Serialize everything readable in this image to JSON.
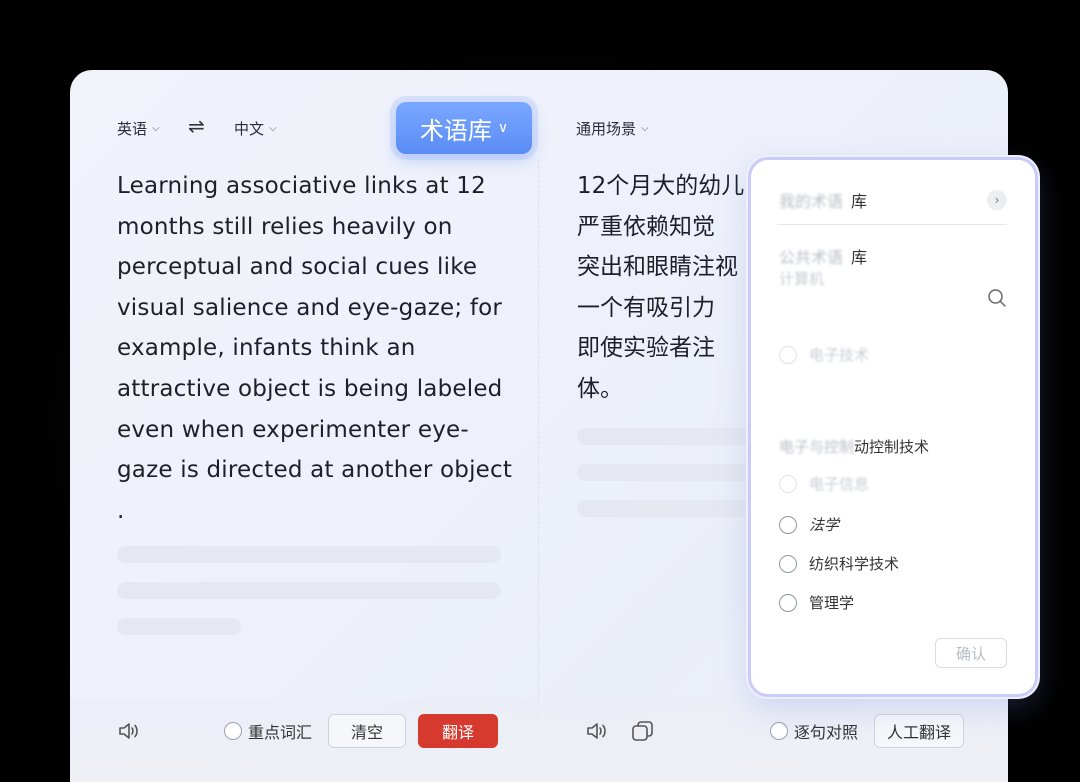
{
  "header": {
    "source_lang": "英语",
    "target_lang": "中文",
    "swap_symbol": "⇌",
    "term_button": "术语库",
    "scene_selector": "通用场景"
  },
  "source_text": "Learning associative links at 12 months still relies heavily on perceptual and social cues like visual salience and eye-gaze; for example, infants think an attractive object is being labeled even when experimenter eye-gaze is directed at another object .",
  "target_text": "12个月大的幼儿\n严重依赖知觉\n突出和眼睛注视\n一个有吸引力\n即使实验者注\n体。",
  "toolbar_left": {
    "key_vocab_label": "重点词汇",
    "clear_label": "清空",
    "translate_label": "翻译"
  },
  "toolbar_right": {
    "sentence_compare_label": "逐句对照",
    "human_translate_label": "人工翻译"
  },
  "term_panel": {
    "row1_blurred": "我的术语",
    "row1_suffix": "库",
    "row2_blurred": "公共术语",
    "row2_suffix": "库",
    "faint_items": [
      "计算机",
      "",
      "电子技术",
      "",
      ""
    ],
    "category_blurred": "电子与控制",
    "category_suffix": "动控制技术",
    "options": [
      {
        "label": "电子信息",
        "faint": true
      },
      {
        "label": "法学",
        "faint": false
      },
      {
        "label": "纺织科学技术",
        "faint": false
      },
      {
        "label": "管理学",
        "faint": false
      }
    ],
    "confirm_label": "确认"
  },
  "colors": {
    "accent_blue": "#5a8cf6",
    "translate_red": "#d63a2e",
    "panel_border": "#c9ccf8"
  }
}
